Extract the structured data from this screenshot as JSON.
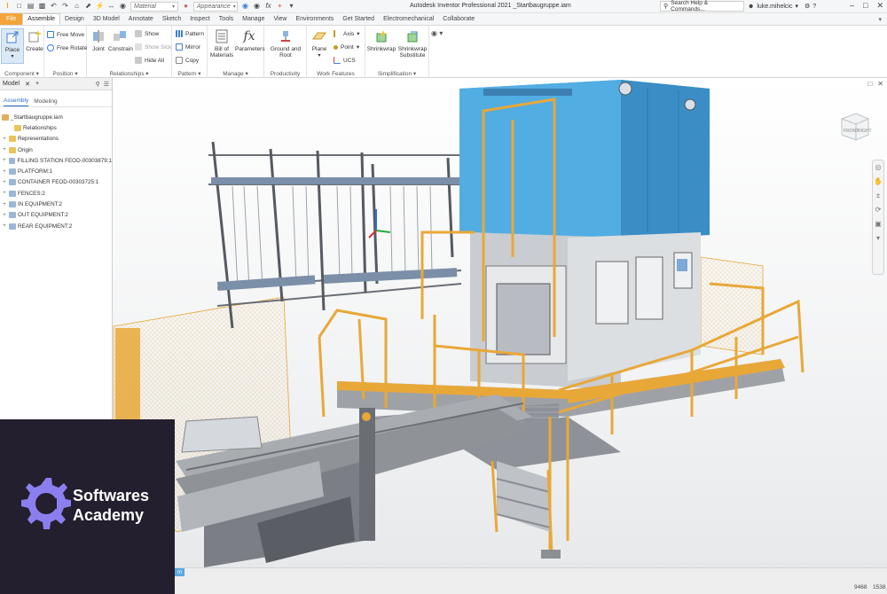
{
  "app": {
    "title": "Autodesk Inventor Professional 2021   _Startbaugruppe.iam"
  },
  "quick_access": {
    "material_placeholder": "Material",
    "appearance_placeholder": "Appearance"
  },
  "search": {
    "label": "Search Help & Commands..."
  },
  "user": {
    "name": "luke.mihelcic"
  },
  "tabs": [
    {
      "label": "File"
    },
    {
      "label": "Assemble"
    },
    {
      "label": "Design"
    },
    {
      "label": "3D Model"
    },
    {
      "label": "Annotate"
    },
    {
      "label": "Sketch"
    },
    {
      "label": "Inspect"
    },
    {
      "label": "Tools"
    },
    {
      "label": "Manage"
    },
    {
      "label": "View"
    },
    {
      "label": "Environments"
    },
    {
      "label": "Get Started"
    },
    {
      "label": "Electromechanical"
    },
    {
      "label": "Collaborate"
    }
  ],
  "ribbon": {
    "component": {
      "title": "Component ▾",
      "place": "Place",
      "create": "Create"
    },
    "position": {
      "title": "Position ▾",
      "free_move": "Free Move",
      "free_rotate": "Free Rotate"
    },
    "relationships": {
      "title": "Relationships ▾",
      "joint": "Joint",
      "constrain": "Constrain",
      "show": "Show",
      "show_sick": "Show Sick",
      "hide_all": "Hide All"
    },
    "pattern": {
      "title": "Pattern ▾",
      "pattern": "Pattern",
      "mirror": "Mirror",
      "copy": "Copy"
    },
    "manage": {
      "title": "Manage ▾",
      "bom_line1": "Bill of",
      "bom_line2": "Materials",
      "parameters": "Parameters"
    },
    "productivity": {
      "title": "Productivity",
      "ground_line1": "Ground and",
      "ground_line2": "Root"
    },
    "work_features": {
      "title": "Work Features",
      "plane": "Plane",
      "axis": "Axis",
      "point": "Point",
      "ucs": "UCS"
    },
    "simplification": {
      "title": "Simplification ▾",
      "shrinkwrap": "Shrinkwrap",
      "sub_line1": "Shrinkwrap",
      "sub_line2": "Substitute"
    }
  },
  "browser": {
    "title": "Model",
    "tabs": [
      "Assembly",
      "Modeling"
    ],
    "root": "_Startbaugruppe.iam",
    "nodes": [
      {
        "label": "Relationships"
      },
      {
        "label": "Representations"
      },
      {
        "label": "Origin"
      },
      {
        "label": "FILLING STATION FEOD-00303879:1"
      },
      {
        "label": "PLATFORM:1"
      },
      {
        "label": "CONTAINER FEOD-00303725:1"
      },
      {
        "label": "FENCES:2"
      },
      {
        "label": "IN EQUIPMENT:2"
      },
      {
        "label": "OUT EQUIPMENT:2"
      },
      {
        "label": "REAR EQUIPMENT:2"
      }
    ]
  },
  "viewcube": {
    "front": "FRONT",
    "right": "RIGHT"
  },
  "status": {
    "doc_tab": "m",
    "count1": "9468",
    "count2": "1538"
  },
  "watermark": {
    "line1": "Softwares",
    "line2": "Academy"
  },
  "colors": {
    "file_tab": "#f4a43b",
    "machine_blue": "#4aa3d9",
    "railing_orange": "#e8a838",
    "watermark_bg": "#231f2e",
    "watermark_logo": "#8b7ff0"
  }
}
